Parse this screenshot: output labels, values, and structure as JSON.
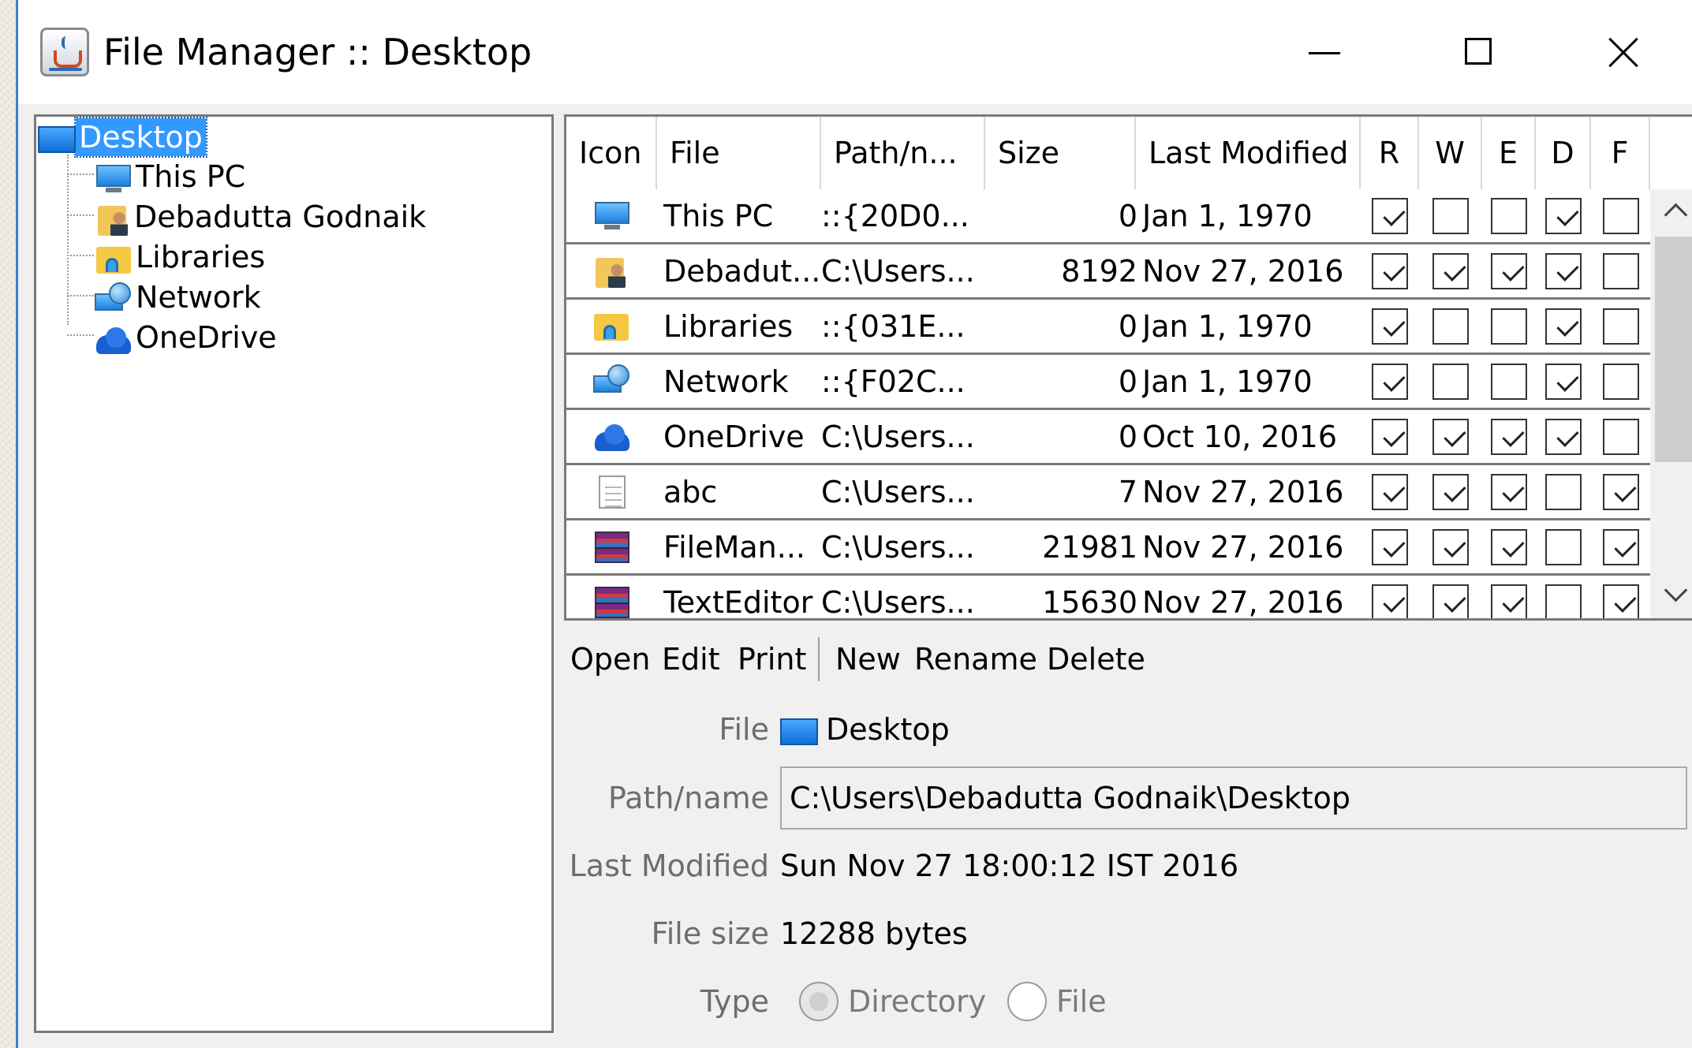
{
  "window": {
    "title": "File Manager :: Desktop"
  },
  "tree": {
    "root": {
      "label": "Desktop",
      "icon": "desktop-icon"
    },
    "children": [
      {
        "label": "This PC",
        "icon": "monitor-icon"
      },
      {
        "label": "Debadutta Godnaik",
        "icon": "user-folder-icon"
      },
      {
        "label": "Libraries",
        "icon": "libraries-icon"
      },
      {
        "label": "Network",
        "icon": "network-icon"
      },
      {
        "label": "OneDrive",
        "icon": "onedrive-icon"
      }
    ]
  },
  "table": {
    "columns": [
      "Icon",
      "File",
      "Path/n...",
      "Size",
      "Last Modified",
      "R",
      "W",
      "E",
      "D",
      "F"
    ],
    "rows": [
      {
        "icon": "monitor-icon",
        "file": "This PC",
        "path": "::{20D0...",
        "size": "0",
        "modified": "Jan 1, 1970",
        "r": true,
        "w": false,
        "e": false,
        "d": true,
        "f": false
      },
      {
        "icon": "user-folder-icon",
        "file": "Debadut...",
        "path": "C:\\Users...",
        "size": "8192",
        "modified": "Nov 27, 2016",
        "r": true,
        "w": true,
        "e": true,
        "d": true,
        "f": false
      },
      {
        "icon": "libraries-icon",
        "file": "Libraries",
        "path": "::{031E...",
        "size": "0",
        "modified": "Jan 1, 1970",
        "r": true,
        "w": false,
        "e": false,
        "d": true,
        "f": false
      },
      {
        "icon": "network-icon",
        "file": "Network",
        "path": "::{F02C...",
        "size": "0",
        "modified": "Jan 1, 1970",
        "r": true,
        "w": false,
        "e": false,
        "d": true,
        "f": false
      },
      {
        "icon": "onedrive-icon",
        "file": "OneDrive",
        "path": "C:\\Users...",
        "size": "0",
        "modified": "Oct 10, 2016",
        "r": true,
        "w": true,
        "e": true,
        "d": true,
        "f": false
      },
      {
        "icon": "text-file-icon",
        "file": "abc",
        "path": "C:\\Users...",
        "size": "7",
        "modified": "Nov 27, 2016",
        "r": true,
        "w": true,
        "e": true,
        "d": false,
        "f": true
      },
      {
        "icon": "archive-icon",
        "file": "FileMan...",
        "path": "C:\\Users...",
        "size": "21981",
        "modified": "Nov 27, 2016",
        "r": true,
        "w": true,
        "e": true,
        "d": false,
        "f": true
      },
      {
        "icon": "archive-icon",
        "file": "TextEditor",
        "path": "C:\\Users...",
        "size": "15630",
        "modified": "Nov 27, 2016",
        "r": true,
        "w": true,
        "e": true,
        "d": false,
        "f": true
      }
    ]
  },
  "toolbar": {
    "open": "Open",
    "edit": "Edit",
    "print": "Print",
    "new": "New",
    "rename": "Rename",
    "delete": "Delete"
  },
  "details": {
    "file_label": "File",
    "file_value": "Desktop",
    "path_label": "Path/name",
    "path_value": "C:\\Users\\Debadutta Godnaik\\Desktop",
    "modified_label": "Last Modified",
    "modified_value": "Sun Nov 27 18:00:12 IST 2016",
    "size_label": "File size",
    "size_value": "12288 bytes",
    "type_label": "Type",
    "type_directory": "Directory",
    "type_file": "File",
    "type_selected": "Directory"
  }
}
